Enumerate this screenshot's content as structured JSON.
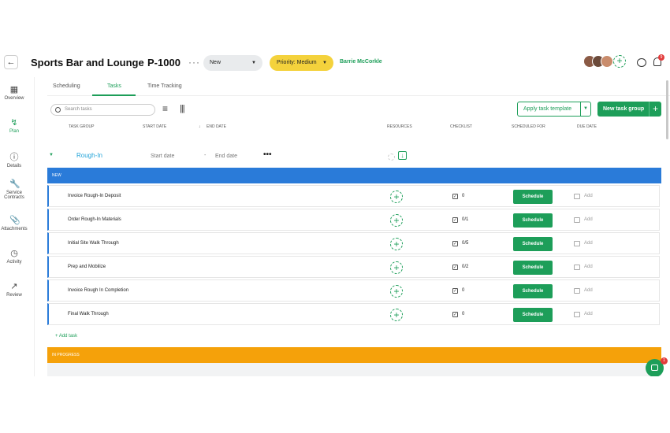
{
  "header": {
    "back_icon": "arrow-left-icon",
    "title": "Sports Bar and Lounge",
    "project_id": "P-1000",
    "more": "···",
    "status": "New",
    "priority": "Priority: Medium",
    "assignee": "Barrie McCorkle",
    "notification_count": "9"
  },
  "sidebar": {
    "items": [
      {
        "label": "Overview",
        "icon": "grid-icon"
      },
      {
        "label": "Plan",
        "icon": "route-icon"
      },
      {
        "label": "Details",
        "icon": "info-icon"
      },
      {
        "label": "Service Contracts",
        "icon": "wrench-icon"
      },
      {
        "label": "Attachments",
        "icon": "paperclip-icon"
      },
      {
        "label": "Activity",
        "icon": "clock-icon"
      },
      {
        "label": "Review",
        "icon": "chart-icon"
      }
    ]
  },
  "tabs": [
    {
      "label": "Scheduling"
    },
    {
      "label": "Tasks"
    },
    {
      "label": "Time Tracking"
    }
  ],
  "toolbar": {
    "search_placeholder": "Search tasks",
    "apply_template": "Apply task template",
    "new_group": "New task group"
  },
  "columns": {
    "task_group": "Task Group",
    "start_date": "Start Date",
    "end_date": "End Date",
    "resources": "Resources",
    "checklist": "Checklist",
    "scheduled_for": "Scheduled For",
    "due_date": "Due Date"
  },
  "group": {
    "name": "Rough-In",
    "start_placeholder": "Start date",
    "dash": "-",
    "end_placeholder": "End date",
    "more": "•••"
  },
  "status_new": "NEW",
  "status_in_progress": "IN PROGRESS",
  "tasks": [
    {
      "name": "Invoice Rough-In Deposit",
      "checklist": "0",
      "schedule": "Schedule",
      "due": "Add"
    },
    {
      "name": "Order Rough-In Materials",
      "checklist": "0/1",
      "schedule": "Schedule",
      "due": "Add"
    },
    {
      "name": "Initial Site Walk Through",
      "checklist": "0/5",
      "schedule": "Schedule",
      "due": "Add"
    },
    {
      "name": "Prep and Mobilize",
      "checklist": "0/2",
      "schedule": "Schedule",
      "due": "Add"
    },
    {
      "name": "Invoice Rough In Completion",
      "checklist": "0",
      "schedule": "Schedule",
      "due": "Add"
    },
    {
      "name": "Final Walk Through",
      "checklist": "0",
      "schedule": "Schedule",
      "due": "Add"
    }
  ],
  "add_task": "+ Add task",
  "help_badge": "1",
  "colors": {
    "accent": "#1d9e59",
    "status_new": "#2a7bd9",
    "status_in_progress": "#f5a10a",
    "priority": "#f4d23c"
  }
}
